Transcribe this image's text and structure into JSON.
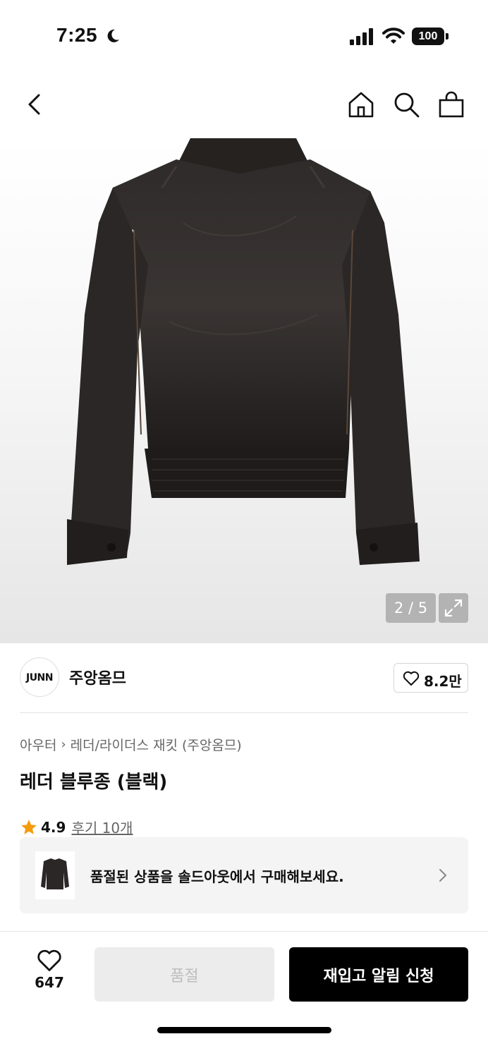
{
  "status_bar": {
    "time": "7:25",
    "battery": "100"
  },
  "product": {
    "image_counter": "2 / 5",
    "brand_logo_text": "JUNN",
    "brand_name": "주앙옴므",
    "brand_likes": "8.2만",
    "breadcrumb": [
      "아우터",
      "레더/라이더스 재킷 (주앙옴므)"
    ],
    "title": "레더 블루종 (블랙)",
    "rating": "4.9",
    "reviews": "후기 10개",
    "soldout_banner": "품절된 상품을 솔드아웃에서 구매해보세요."
  },
  "bottom_bar": {
    "likes": "647",
    "soldout_label": "품절",
    "restock_label": "재입고 알림 신청"
  },
  "colors": {
    "accent": "#000000",
    "star": "#f59b0b",
    "background": "#ffffff"
  },
  "icons": [
    "moon-icon",
    "signal-icon",
    "wifi-icon",
    "back-icon",
    "home-icon",
    "search-icon",
    "bag-icon",
    "expand-icon",
    "heart-icon",
    "star-icon",
    "chevron-right-icon"
  ]
}
